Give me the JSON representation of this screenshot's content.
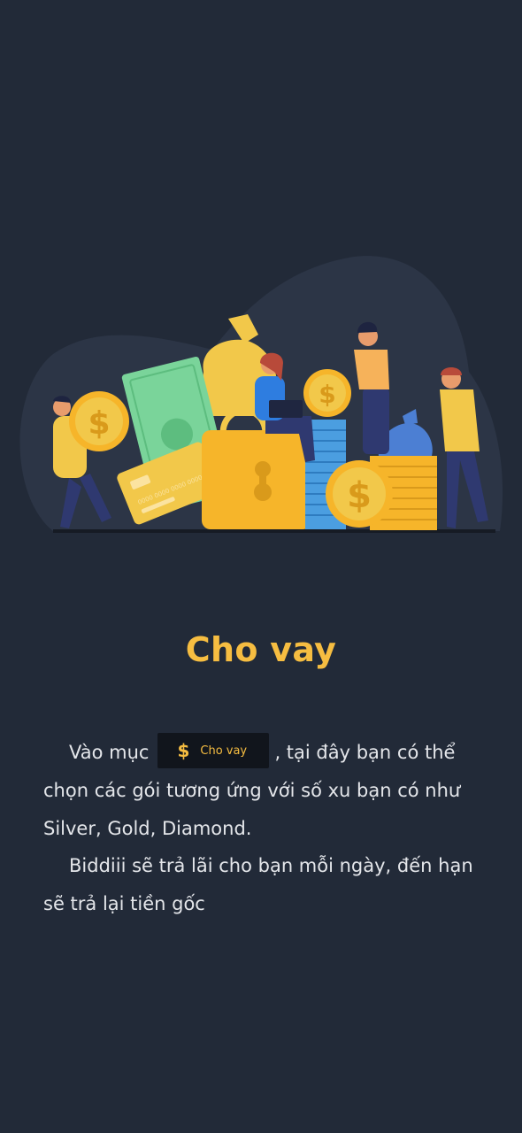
{
  "screen": {
    "title": "Cho vay",
    "paragraph1": {
      "before": "Vào mục",
      "button_icon": "$",
      "button_label": "Cho vay",
      "after": ", tại đây bạn có thể chọn các gói tương ứng với số xu bạn có như Silver, Gold, Diamond."
    },
    "paragraph2": "Biddiii sẽ trả lãi cho bạn mỗi ngày, đến hạn sẽ trả lại tiền gốc",
    "card_number": "0000 0000 0000 0000"
  },
  "colors": {
    "background": "#222a38",
    "accent": "#f6bd41",
    "text": "#e4e6ea"
  },
  "icons": [
    "dollar-icon",
    "coin-icon",
    "money-bag-icon",
    "padlock-icon",
    "credit-card-icon",
    "banknote-icon"
  ]
}
